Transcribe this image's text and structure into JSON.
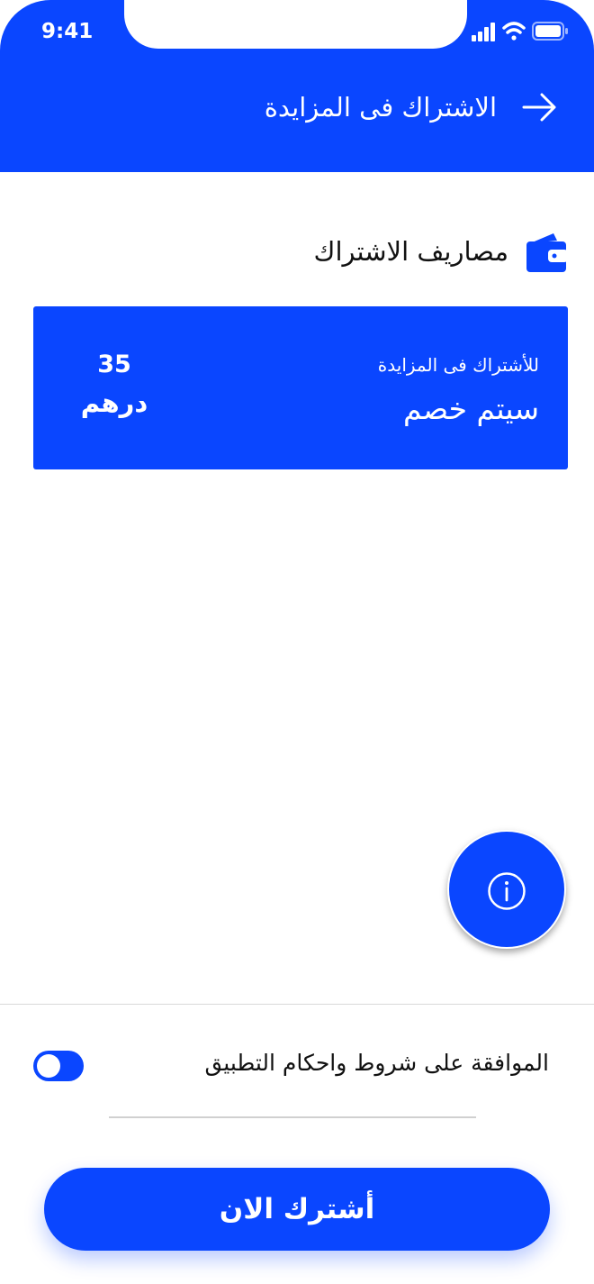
{
  "status_bar": {
    "time": "9:41"
  },
  "header": {
    "title": "الاشتراك فى المزايدة",
    "back_icon": "arrow-right-icon"
  },
  "section": {
    "title": "مصاريف الاشتراك",
    "icon": "wallet-icon"
  },
  "fee_card": {
    "caption": "للأشتراك فى المزايدة",
    "label": "سيتم خصم",
    "amount": "35",
    "currency": "درهم"
  },
  "info_button": {
    "icon": "info-icon"
  },
  "terms": {
    "label": "الموافقة على شروط واحكام التطبيق",
    "toggle_on": true
  },
  "subscribe_button": {
    "label": "أشترك الان"
  },
  "colors": {
    "primary": "#0A46FF",
    "background": "#FFFFFF",
    "text": "#111111"
  }
}
